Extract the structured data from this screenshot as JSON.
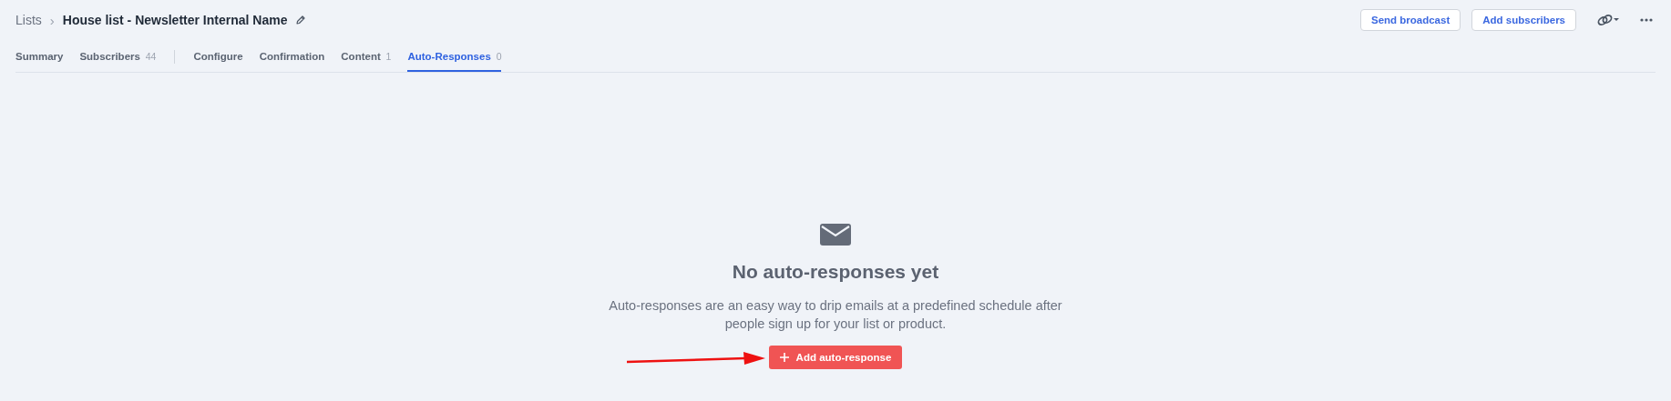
{
  "breadcrumb": {
    "parent": "Lists",
    "separator": "›",
    "title": "House list - Newsletter Internal Name"
  },
  "actions": [
    "Send broadcast",
    "Add subscribers"
  ],
  "tab_groups": [
    [
      {
        "label": "Summary",
        "selected": false
      },
      {
        "label": "Subscribers",
        "count": "44",
        "selected": false
      }
    ],
    [
      {
        "label": "Configure",
        "selected": false
      },
      {
        "label": "Confirmation",
        "selected": false
      },
      {
        "label": "Content",
        "count": "1",
        "selected": false
      },
      {
        "label": "Auto-Responses",
        "count": "0",
        "selected": true
      }
    ]
  ],
  "empty_state": {
    "heading": "No auto-responses yet",
    "text": "Auto-responses are an easy way to drip emails at a predefined schedule after people sign up for your list or product.",
    "button": "Add auto-response"
  }
}
